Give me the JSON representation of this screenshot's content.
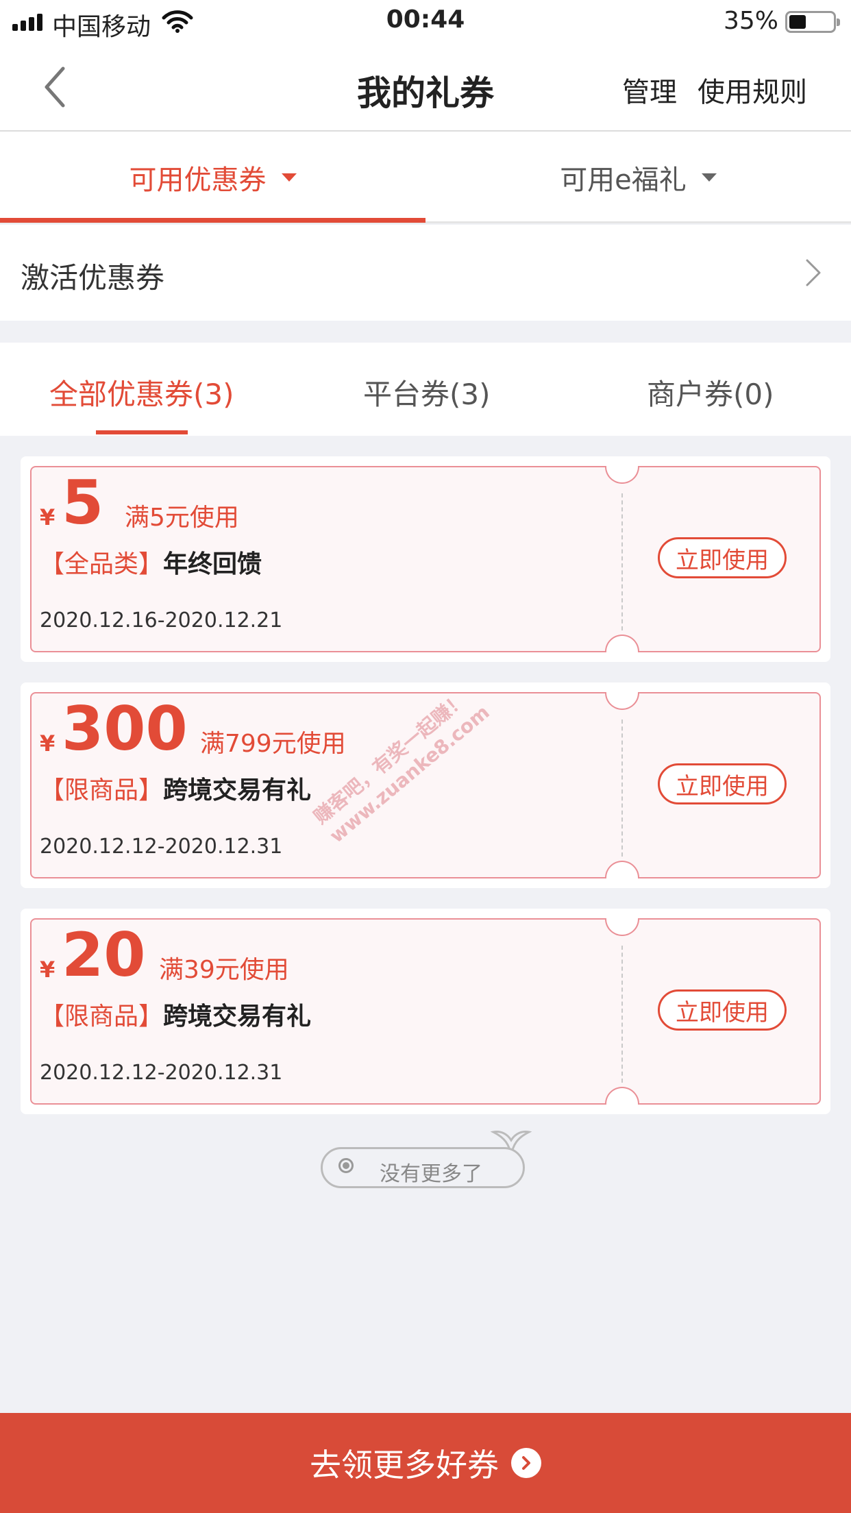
{
  "status_bar": {
    "carrier": "中国移动",
    "time": "00:44",
    "battery_percent": "35%",
    "battery_level": 0.35
  },
  "nav": {
    "title": "我的礼券",
    "manage": "管理",
    "rules": "使用规则"
  },
  "main_tabs": [
    {
      "label": "可用优惠券",
      "active": true
    },
    {
      "label": "可用e福礼",
      "active": false
    }
  ],
  "activate": {
    "label": "激活优惠券"
  },
  "sub_tabs": [
    {
      "label": "全部优惠券(3)",
      "active": true
    },
    {
      "label": "平台券(3)",
      "active": false
    },
    {
      "label": "商户券(0)",
      "active": false
    }
  ],
  "coupons": [
    {
      "currency": "¥",
      "amount": "5",
      "threshold": "满5元使用",
      "tag": "【全品类】",
      "title": "年终回馈",
      "dates": "2020.12.16-2020.12.21",
      "button": "立即使用"
    },
    {
      "currency": "¥",
      "amount": "300",
      "threshold": "满799元使用",
      "tag": "【限商品】",
      "title": "跨境交易有礼",
      "dates": "2020.12.12-2020.12.31",
      "button": "立即使用"
    },
    {
      "currency": "¥",
      "amount": "20",
      "threshold": "满39元使用",
      "tag": "【限商品】",
      "title": "跨境交易有礼",
      "dates": "2020.12.12-2020.12.31",
      "button": "立即使用"
    }
  ],
  "no_more": "没有更多了",
  "watermark": {
    "line1": "赚客吧，有奖一起赚！",
    "line2": "www.zuanke8.com"
  },
  "bottom_bar": {
    "label": "去领更多好券"
  },
  "colors": {
    "accent": "#e24b37",
    "bottom_bar": "#d84b38",
    "coupon_border": "#ea8f96",
    "coupon_bg": "#fdf6f7"
  }
}
